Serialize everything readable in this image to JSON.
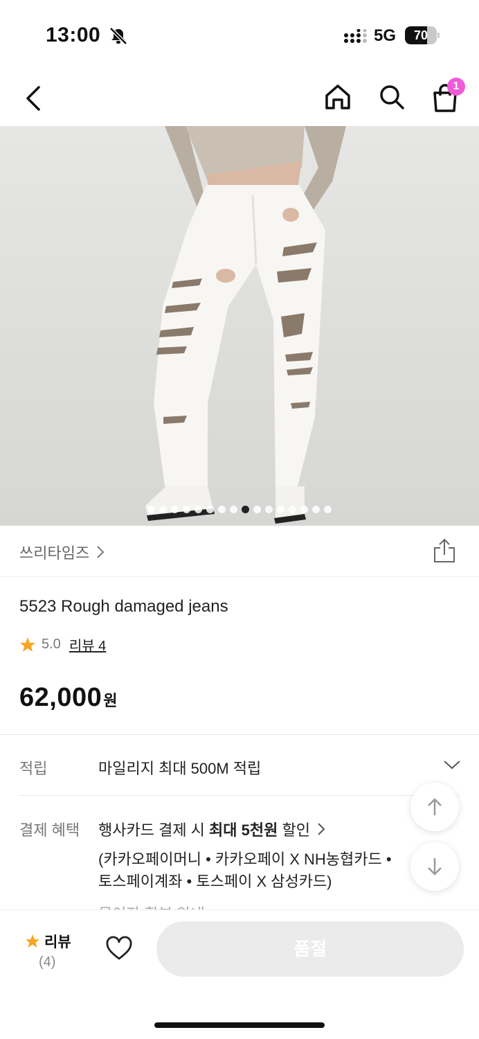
{
  "status_bar": {
    "time": "13:00",
    "network": "5G",
    "battery": "70",
    "battery_level": 0.7
  },
  "nav": {
    "cart_count": "1"
  },
  "gallery": {
    "total": 16,
    "active_index": 8
  },
  "brand": {
    "name": "쓰리타임즈"
  },
  "product": {
    "name": "5523 Rough damaged jeans",
    "rating": "5.0",
    "review_label": "리뷰 4",
    "price": "62,000",
    "currency": "원"
  },
  "mileage": {
    "label": "적립",
    "text": "마일리지 최대 500M 적립"
  },
  "payment": {
    "label": "결제 혜택",
    "text_prefix": "행사카드 결제 시 ",
    "text_bold": "최대 5천원",
    "text_suffix": " 할인",
    "cards_line1": "(카카오페이머니 • 카카오페이 X NH농협카드 •",
    "cards_line2": "토스페이계좌 • 토스페이 X 삼성카드)",
    "cut_text": "무이자 할부 안내"
  },
  "bottom": {
    "review_title": "리뷰",
    "review_count": "(4)",
    "soldout_label": "품절"
  },
  "colors": {
    "badge": "#f05ad6",
    "star": "#f6a623",
    "soldout_bg": "#ebebeb"
  }
}
